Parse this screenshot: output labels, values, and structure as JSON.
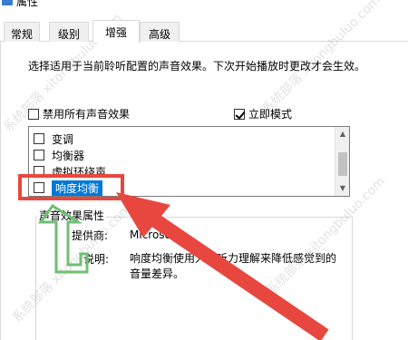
{
  "window": {
    "title": "属性",
    "icon": "speaker-icon"
  },
  "tabs": [
    {
      "label": "常规",
      "active": false
    },
    {
      "label": "级别",
      "active": false
    },
    {
      "label": "增强",
      "active": true
    },
    {
      "label": "高级",
      "active": false
    }
  ],
  "enhancements": {
    "description": "选择适用于当前聆听配置的声音效果。下次开始播放时更改才会生效。",
    "disable_all": {
      "label": "禁用所有声音效果",
      "checked": false
    },
    "immediate_mode": {
      "label": "立即模式",
      "checked": true
    },
    "effects": [
      {
        "label": "变调",
        "checked": false,
        "selected": false
      },
      {
        "label": "均衡器",
        "checked": false,
        "selected": false
      },
      {
        "label": "虚拟环绕声",
        "checked": false,
        "selected": false
      },
      {
        "label": "响度均衡",
        "checked": false,
        "selected": true
      }
    ]
  },
  "properties": {
    "group_title": "声音效果属性",
    "provider_label": "提供商:",
    "provider_value": "Microsoft",
    "description_label": "说明:",
    "description_value": "响度均衡使用人的听力理解来降低感觉到的音量差异。"
  },
  "watermark": {
    "text": "系统部落 xitongbuluo.com"
  },
  "annotation_colors": {
    "red_arrow": "#e8473f",
    "green_arrow": "#6fbf73"
  }
}
